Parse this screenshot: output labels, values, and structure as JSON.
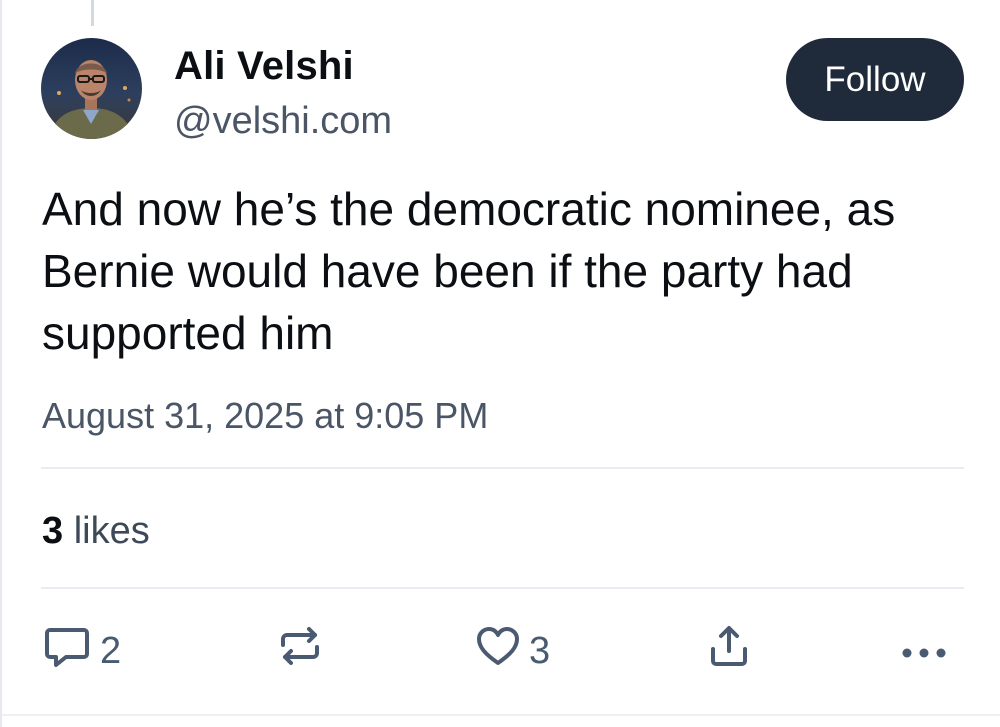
{
  "author": {
    "name": "Ali Velshi",
    "handle": "@velshi.com"
  },
  "follow_label": "Follow",
  "post": {
    "text": "And now he’s the democratic nominee, as Bernie would have been if the party had supported him",
    "timestamp": "August 31, 2025 at 9:05 PM"
  },
  "likes_summary": {
    "count": "3",
    "label": "likes"
  },
  "actions": {
    "reply_count": "2",
    "like_count": "3"
  },
  "icons": [
    "reply-icon",
    "repost-icon",
    "heart-icon",
    "share-icon",
    "more-icon"
  ],
  "colors": {
    "follow_button": "#1f2a3a",
    "secondary_text": "#4a5566",
    "action_icon": "#4a5a70"
  }
}
